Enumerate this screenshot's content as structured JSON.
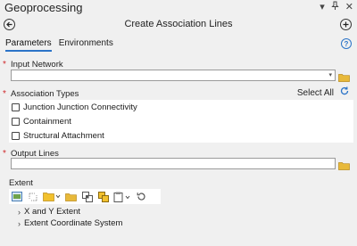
{
  "pane": {
    "title": "Geoprocessing"
  },
  "tool": {
    "title": "Create Association Lines"
  },
  "tabs": [
    {
      "label": "Parameters"
    },
    {
      "label": "Environments"
    }
  ],
  "params": {
    "input_network": {
      "label": "Input Network",
      "value": ""
    },
    "association_types": {
      "label": "Association Types",
      "select_all": "Select All",
      "options": [
        {
          "label": "Junction Junction Connectivity",
          "checked": false
        },
        {
          "label": "Containment",
          "checked": false
        },
        {
          "label": "Structural Attachment",
          "checked": false
        }
      ]
    },
    "output_lines": {
      "label": "Output Lines",
      "value": ""
    },
    "extent": {
      "label": "Extent",
      "sections": [
        {
          "label": "X and Y Extent"
        },
        {
          "label": "Extent Coordinate System"
        }
      ]
    }
  },
  "icons": {
    "back": "back-arrow-icon",
    "add": "add-icon",
    "help": "help-icon",
    "folder": "folder-icon",
    "refresh": "refresh-icon"
  },
  "colors": {
    "accent": "#2b74c8",
    "required": "#d0282b",
    "folder": "#e8b93a"
  }
}
